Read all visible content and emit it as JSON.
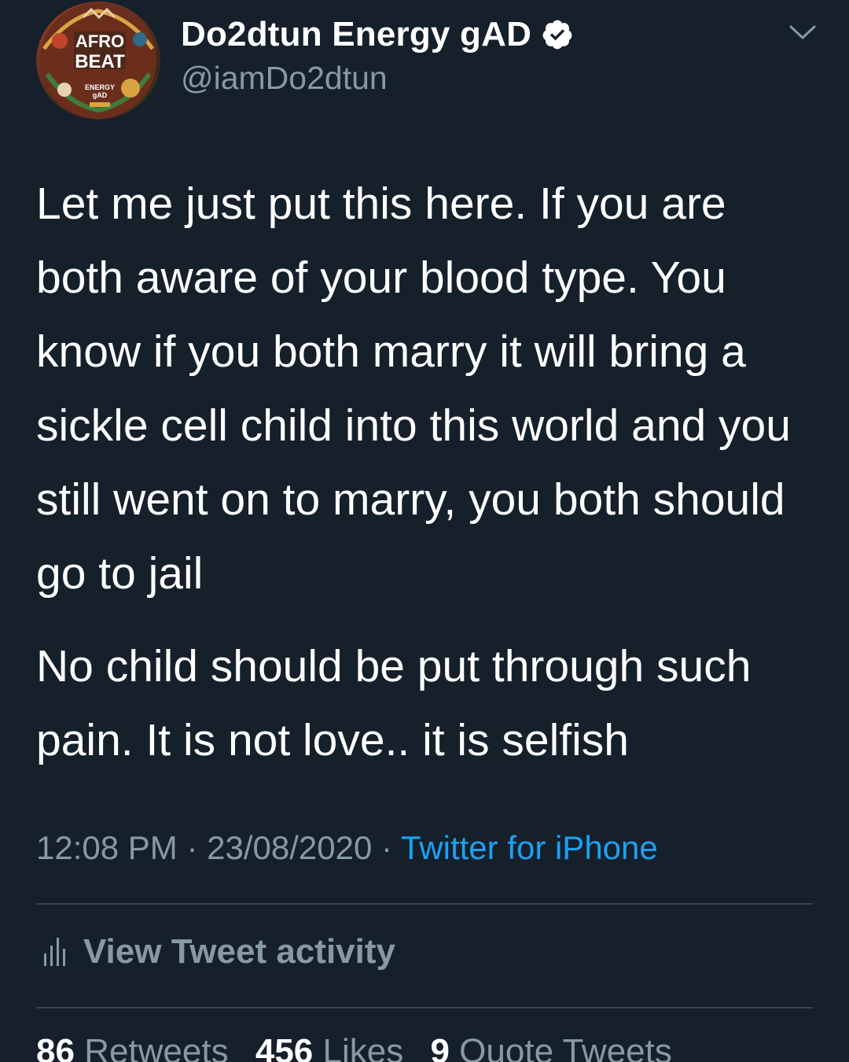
{
  "author": {
    "display_name": "Do2dtun Energy gAD",
    "handle": "@iamDo2dtun",
    "verified": true,
    "avatar_text": [
      "AFRO",
      "BEAT",
      "ENERGY",
      "gAD"
    ]
  },
  "tweet": {
    "paragraphs": [
      "Let me just put this here. If you are both aware of your blood type. You know if you both marry it will bring a sickle cell child into this world and you still went on to marry, you both should go to jail",
      "No child should be put through such pain. It is not love.. it is selfish"
    ],
    "time": "12:08 PM",
    "date": "23/08/2020",
    "separator": "·",
    "source": "Twitter for iPhone"
  },
  "activity": {
    "label": "View Tweet activity"
  },
  "stats": {
    "retweets_count": "86",
    "retweets_label": "Retweets",
    "likes_count": "456",
    "likes_label": "Likes",
    "quotes_count": "9",
    "quotes_label": "Quote Tweets"
  },
  "colors": {
    "background": "#15202b",
    "text_primary": "#ffffff",
    "text_secondary": "#8899a6",
    "accent": "#1da1f2",
    "divider": "#38444d"
  },
  "icons": {
    "verified": "verified-badge-icon",
    "menu": "chevron-down-icon",
    "activity": "bar-chart-icon"
  }
}
